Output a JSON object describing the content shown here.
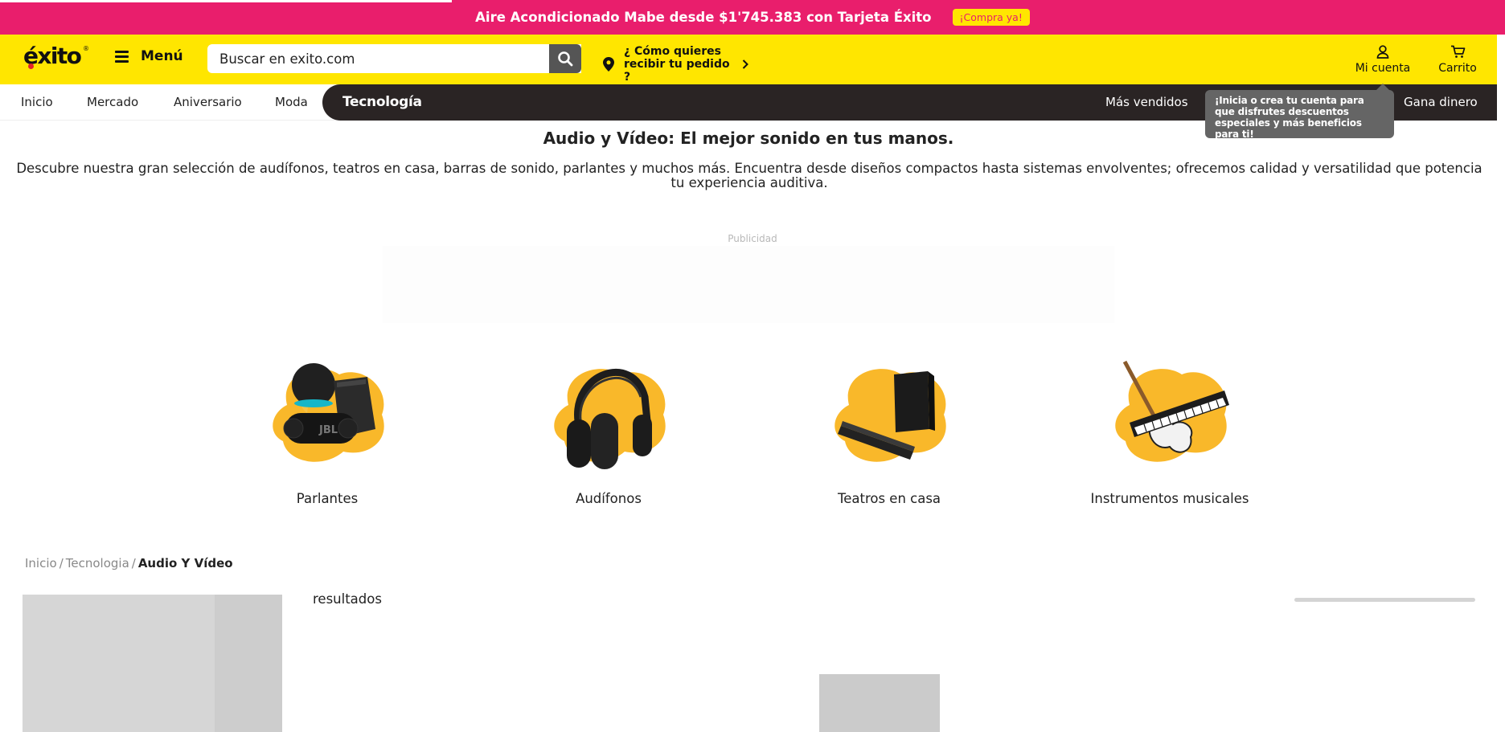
{
  "promo": {
    "text": "Aire Acondicionado Mabe desde $1'745.383 con Tarjeta Éxito",
    "cta": "¡Compra ya!",
    "progress": 0.3
  },
  "header": {
    "logo": "éxito",
    "menu_label": "Menú",
    "search_placeholder": "Buscar en exito.com",
    "delivery_label": "¿ Cómo quieres recibir tu pedido ?",
    "account_label": "Mi cuenta",
    "cart_label": "Carrito"
  },
  "nav": {
    "items": [
      "Inicio",
      "Mercado",
      "Aniversario",
      "Moda"
    ],
    "active": "Tecnología",
    "right": [
      "Más vendidos",
      "Gana dinero"
    ]
  },
  "tooltip": {
    "lead": "¡Inicia o crea tu cuenta para que disfrutes ",
    "bold": "descuentos especiales y más beneficios para ti!"
  },
  "intro": {
    "title": "Audio y Vídeo: El mejor sonido en tus manos.",
    "description": "Descubre nuestra gran selección de audífonos, teatros en casa, barras de sonido, parlantes y muchos más. Encuentra desde diseños compactos hasta sistemas envolventes; ofrecemos calidad y versatilidad que potencia tu experiencia auditiva.",
    "ad_label": "Publicidad"
  },
  "categories": [
    {
      "label": "Parlantes",
      "icon": "speaker-icon"
    },
    {
      "label": "Audífonos",
      "icon": "headphones-icon"
    },
    {
      "label": "Teatros en casa",
      "icon": "home-theater-icon"
    },
    {
      "label": "Instrumentos musicales",
      "icon": "instruments-icon"
    }
  ],
  "breadcrumb": [
    "Inicio",
    "Tecnologia",
    "Audio Y Vídeo"
  ],
  "results": {
    "label": "resultados"
  },
  "colors": {
    "promo_bg": "#e91e6c",
    "header_bg": "#ffe600",
    "nav_dark": "#2a2424",
    "accent_blob": "#f9b82a"
  }
}
